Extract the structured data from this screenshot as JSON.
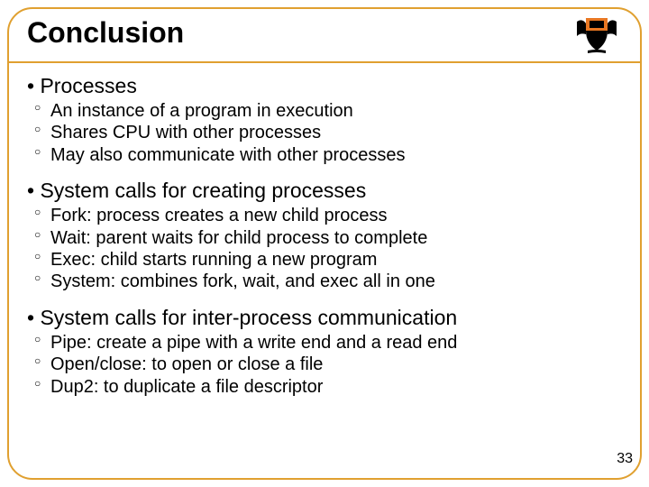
{
  "title": "Conclusion",
  "page_number": "33",
  "sections": [
    {
      "heading": "Processes",
      "items": [
        "An instance of a program in execution",
        "Shares CPU with other processes",
        "May also communicate with other processes"
      ]
    },
    {
      "heading": "System calls for creating processes",
      "items": [
        "Fork: process creates a new child process",
        "Wait: parent waits for child process to complete",
        "Exec: child starts running a new program",
        "System: combines fork, wait, and exec all in one"
      ]
    },
    {
      "heading": "System calls for inter-process communication",
      "items": [
        "Pipe: create a pipe with a write end and a read end",
        "Open/close: to open or close a file",
        "Dup2: to duplicate a file descriptor"
      ]
    }
  ]
}
